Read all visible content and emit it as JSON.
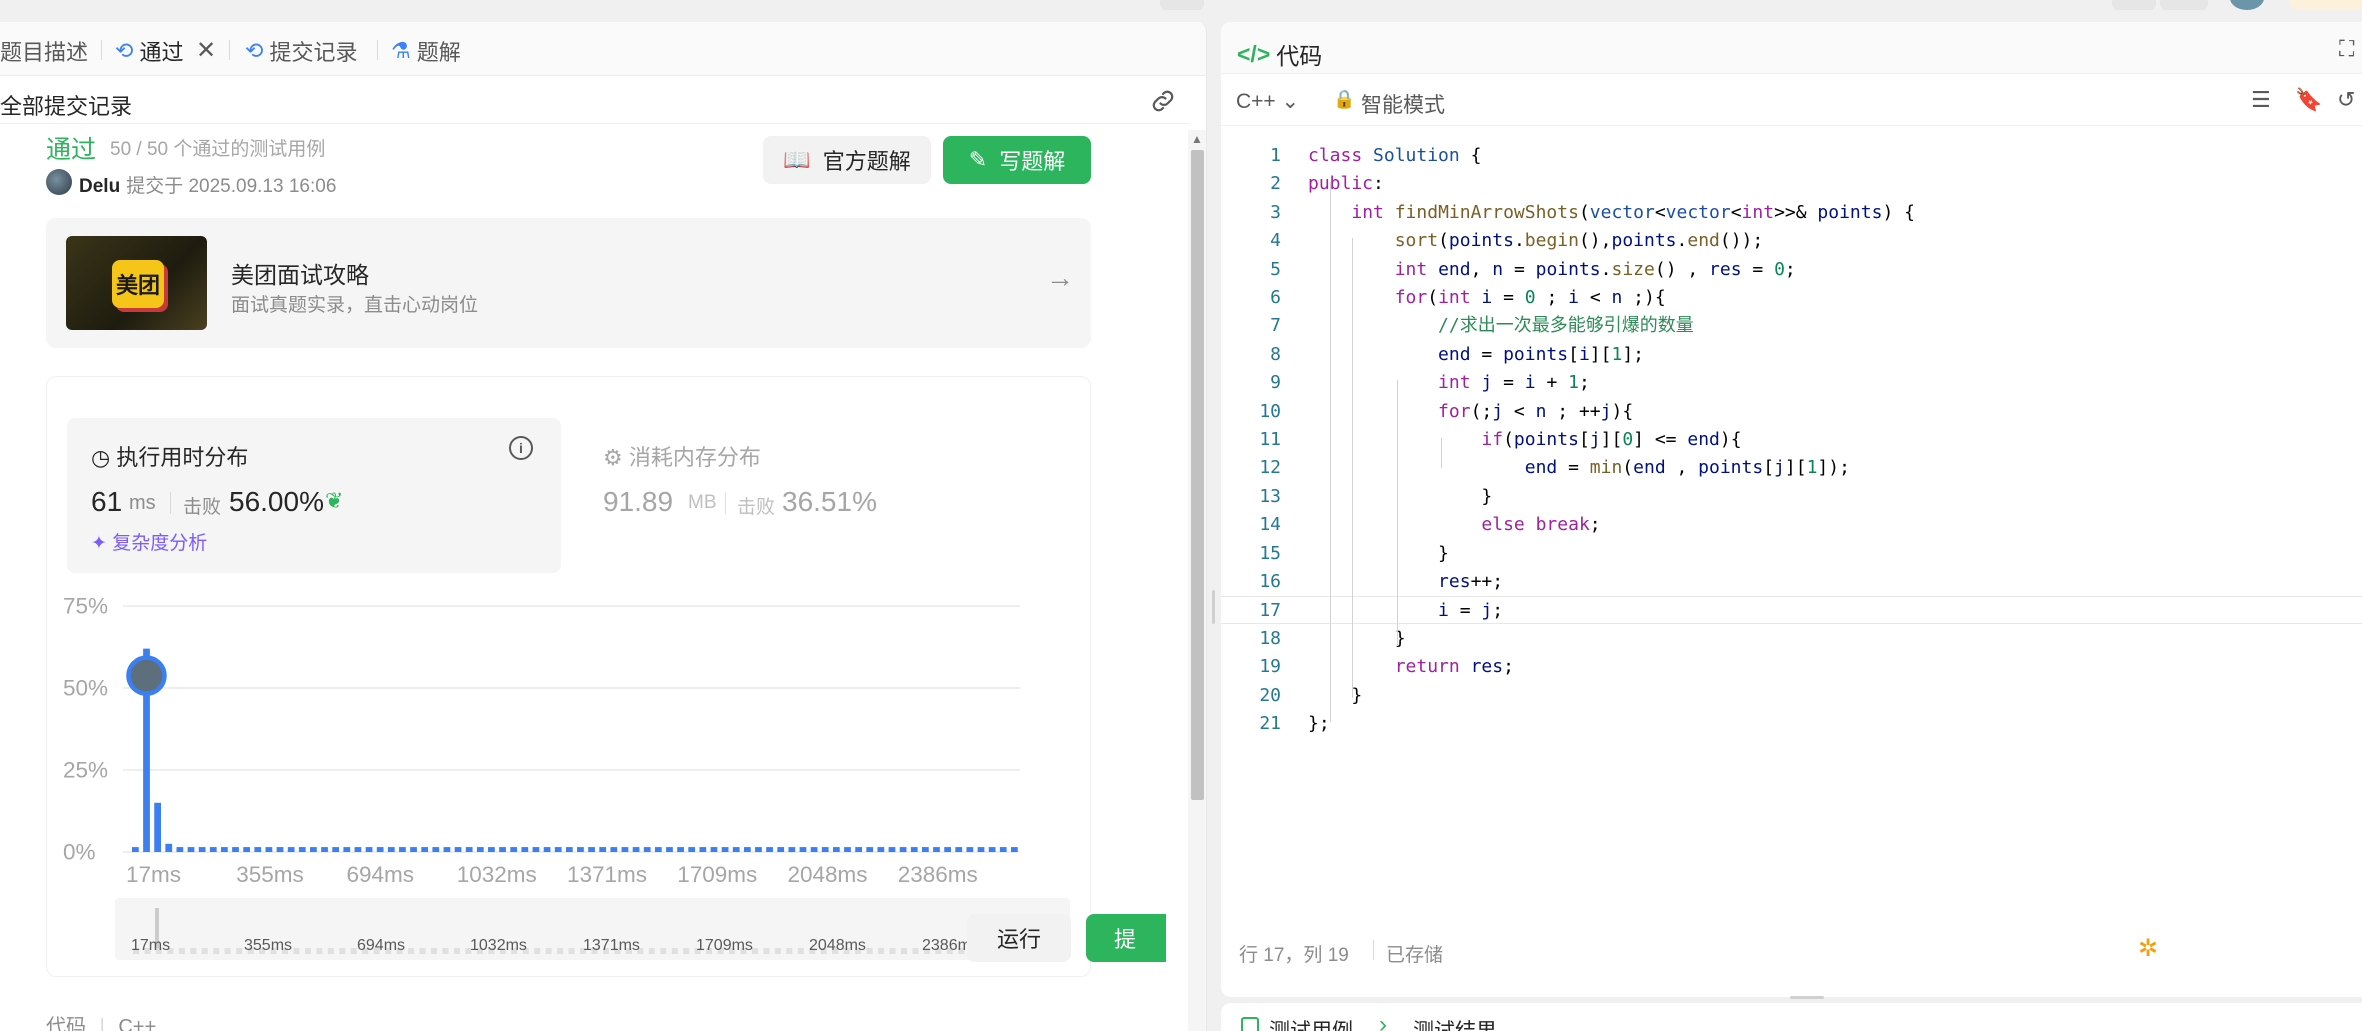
{
  "tabs": {
    "description": "题目描述",
    "accepted": "通过",
    "submissions": "提交记录",
    "solutions": "题解"
  },
  "subheader": {
    "title": "全部提交记录"
  },
  "submission": {
    "status": "通过",
    "cases": "50 / 50 个通过的测试用例",
    "user": "Delu",
    "submitted_at": "提交于 2025.09.13 16:06"
  },
  "buttons": {
    "official": "官方题解",
    "write": "写题解",
    "run": "运行",
    "submit": "提"
  },
  "banner": {
    "logo_text": "美团",
    "title": "美团面试攻略",
    "subtitle": "面试真题实录，直击心动岗位"
  },
  "runtime": {
    "title": "执行用时分布",
    "value": "61",
    "unit": "ms",
    "beat_label": "击败",
    "percent": "56.00%",
    "complexity_link": "复杂度分析"
  },
  "memory": {
    "title": "消耗内存分布",
    "value": "91.89",
    "unit": "MB",
    "beat_label": "击败",
    "percent": "36.51%"
  },
  "chart_data": {
    "type": "bar",
    "ylabel": "",
    "xlabel": "",
    "yticks": [
      "75%",
      "50%",
      "25%",
      "0%"
    ],
    "ylim": [
      0,
      75
    ],
    "xticks": [
      "17ms",
      "355ms",
      "694ms",
      "1032ms",
      "1371ms",
      "1709ms",
      "2048ms",
      "2386ms"
    ],
    "bar_count": 80,
    "values": [
      1.5,
      62,
      15,
      2.5,
      1.5,
      1.5,
      1.5,
      1.5,
      1.5,
      1.5,
      1.5,
      1.5,
      1.5,
      1.5,
      1.5,
      1.5,
      1.5,
      1.5,
      1.5,
      1.5,
      1.5,
      1.5,
      1.5,
      1.5,
      1.5,
      1.5,
      1.5,
      1.5,
      1.5,
      1.5,
      1.5,
      1.5,
      1.5,
      1.5,
      1.5,
      1.5,
      1.5,
      1.5,
      1.5,
      1.5,
      1.5,
      1.5,
      1.5,
      1.5,
      1.5,
      1.5,
      1.5,
      1.5,
      1.5,
      1.5,
      1.5,
      1.5,
      1.5,
      1.5,
      1.5,
      1.5,
      1.5,
      1.5,
      1.5,
      1.5,
      1.5,
      1.5,
      1.5,
      1.5,
      1.5,
      1.5,
      1.5,
      1.5,
      1.5,
      1.5,
      1.5,
      1.5,
      1.5,
      1.5,
      1.5,
      1.5,
      1.5,
      1.5,
      1.5,
      1.5
    ],
    "highlight_index": 1,
    "bar_color": "#3b7ff0"
  },
  "code_section": {
    "label": "代码",
    "lang": "C++"
  },
  "editor_header": {
    "title": "代码",
    "language": "C++",
    "mode": "智能模式"
  },
  "code_lines": [
    {
      "n": "1",
      "t": "class Solution {"
    },
    {
      "n": "2",
      "t": "public:"
    },
    {
      "n": "3",
      "t": "    int findMinArrowShots(vector<vector<int>>& points) {"
    },
    {
      "n": "4",
      "t": "        sort(points.begin(),points.end());"
    },
    {
      "n": "5",
      "t": "        int end, n = points.size() , res = 0;"
    },
    {
      "n": "6",
      "t": "        for(int i = 0 ; i < n ;){"
    },
    {
      "n": "7",
      "t": "            //求出一次最多能够引爆的数量"
    },
    {
      "n": "8",
      "t": "            end = points[i][1];"
    },
    {
      "n": "9",
      "t": "            int j = i + 1;"
    },
    {
      "n": "10",
      "t": "            for(;j < n ; ++j){"
    },
    {
      "n": "11",
      "t": "                if(points[j][0] <= end){"
    },
    {
      "n": "12",
      "t": "                    end = min(end , points[j][1]);"
    },
    {
      "n": "13",
      "t": "                }"
    },
    {
      "n": "14",
      "t": "                else break;"
    },
    {
      "n": "15",
      "t": "            }"
    },
    {
      "n": "16",
      "t": "            res++;"
    },
    {
      "n": "17",
      "t": "            i = j;"
    },
    {
      "n": "18",
      "t": "        }"
    },
    {
      "n": "19",
      "t": "        return res;"
    },
    {
      "n": "20",
      "t": "    }"
    },
    {
      "n": "21",
      "t": "};"
    }
  ],
  "status_bar": {
    "position": "行 17，列 19",
    "saved": "已存储"
  },
  "bottom_tabs": {
    "testcase": "测试用例",
    "result": "测试结果"
  },
  "colors": {
    "accent_green": "#2db55d",
    "accent_blue": "#3b82f6",
    "purple": "#7c5cfc"
  }
}
